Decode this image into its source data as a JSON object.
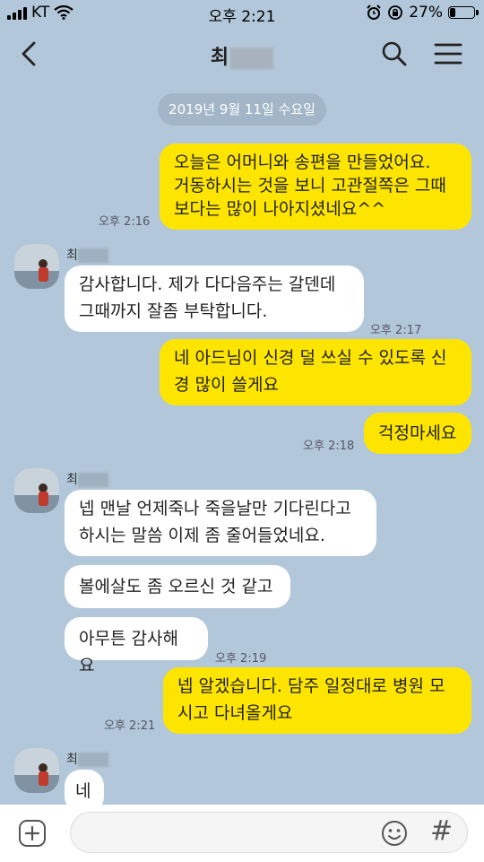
{
  "status_bar": {
    "carrier": "KT",
    "time": "오후 2:21",
    "battery": "27%",
    "battery_level": 0.27
  },
  "header": {
    "title": "최"
  },
  "date_divider": "2019년 9월 11일 수요일",
  "messages": [
    {
      "text": "오늘은 어머니와 송편을 만들었어요.\n거동하시는 것을 보니 고관절쪽은 그때\n보다는 많이 나아지셨네요^^",
      "time": "오후 2:16"
    },
    {
      "name": "최",
      "text": "감사합니다. 제가 다다음주는 갈덴데\n그때까지 잘좀 부탁합니다.",
      "time": "오후 2:17"
    },
    {
      "text": "네 아드님이 신경 덜 쓰실 수 있도록 신\n경 많이 쓸게요"
    },
    {
      "text": "걱정마세요",
      "time": "오후 2:18"
    },
    {
      "name": "최",
      "text": "넵 맨날 언제죽나 죽을날만 기다린다고\n하시는 말씀 이제 좀 줄어들었네요."
    },
    {
      "text": "볼에살도 좀 오르신 것 같고"
    },
    {
      "text": "아무튼 감사해요",
      "time": "오후 2:19"
    },
    {
      "text": "넵 알겠습니다. 담주 일정대로 병원 모\n시고 다녀올게요",
      "time": "오후 2:21"
    },
    {
      "name": "최",
      "text": "네"
    }
  ]
}
